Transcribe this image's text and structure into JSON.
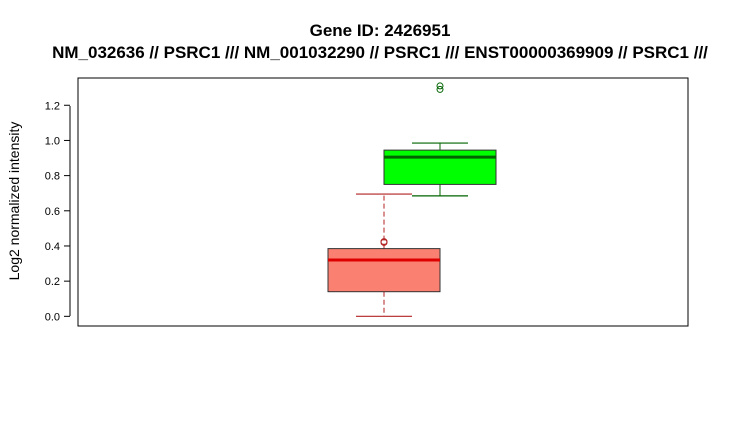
{
  "chart_data": {
    "type": "box",
    "title": "Gene ID: 2426951",
    "subtitle": "NM_032636 // PSRC1 /// NM_001032290 // PSRC1 /// ENST00000369909 // PSRC1 ///",
    "xlabel": "",
    "ylabel": "Log2 normalized intensity",
    "ylim": [
      -0.055,
      1.355
    ],
    "yticks": [
      0.0,
      0.2,
      0.4,
      0.6,
      0.8,
      1.0,
      1.2
    ],
    "ytick_labels": [
      "0.0",
      "0.2",
      "0.4",
      "0.6",
      "0.8",
      "1.0",
      "1.2"
    ],
    "grid": false,
    "series": [
      {
        "fill": "#fa8072",
        "median_color": "#dd0000",
        "whisker_color": "#b22222",
        "whisker_style": "dashed",
        "min": 0.0,
        "q1": 0.14,
        "median": 0.32,
        "q3": 0.385,
        "max": 0.695,
        "outliers": [
          0.42,
          0.425
        ]
      },
      {
        "fill": "#00ff00",
        "median_color": "#006400",
        "whisker_color": "#006400",
        "whisker_style": "solid",
        "min": 0.685,
        "q1": 0.75,
        "median": 0.905,
        "q3": 0.945,
        "max": 0.985,
        "outliers": [
          1.29,
          1.31
        ]
      }
    ]
  }
}
